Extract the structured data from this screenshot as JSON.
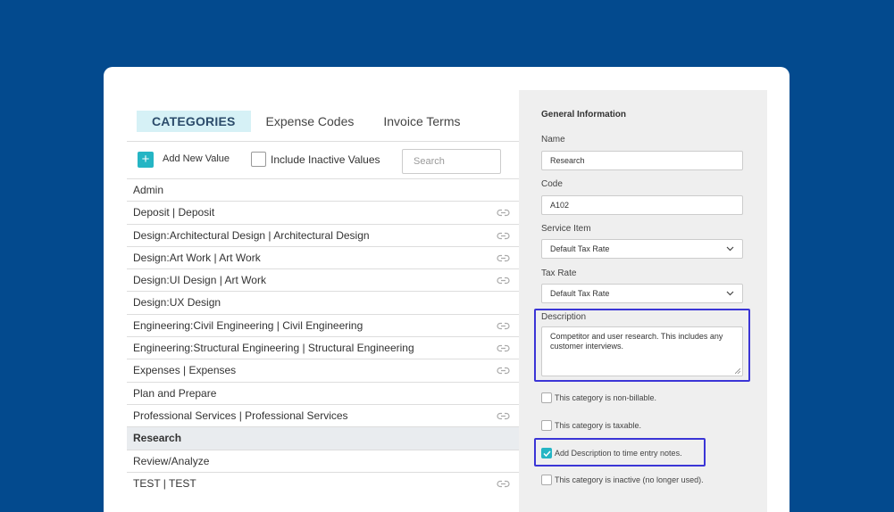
{
  "tabs": [
    {
      "label": "CATEGORIES"
    },
    {
      "label": "Expense Codes"
    },
    {
      "label": "Invoice Terms"
    }
  ],
  "toolbar": {
    "add_label": "Add New Value",
    "include_inactive_label": "Include Inactive Values",
    "search_placeholder": "Search"
  },
  "categories": [
    {
      "label": "Admin",
      "linked": false,
      "selected": false
    },
    {
      "label": "Deposit | Deposit",
      "linked": true,
      "selected": false
    },
    {
      "label": "Design:Architectural Design | Architectural Design",
      "linked": true,
      "selected": false
    },
    {
      "label": "Design:Art Work | Art Work",
      "linked": true,
      "selected": false
    },
    {
      "label": "Design:UI Design | Art Work",
      "linked": true,
      "selected": false
    },
    {
      "label": "Design:UX Design",
      "linked": false,
      "selected": false
    },
    {
      "label": "Engineering:Civil Engineering | Civil Engineering",
      "linked": true,
      "selected": false
    },
    {
      "label": "Engineering:Structural Engineering | Structural Engineering",
      "linked": true,
      "selected": false
    },
    {
      "label": "Expenses | Expenses",
      "linked": true,
      "selected": false
    },
    {
      "label": "Plan and Prepare",
      "linked": false,
      "selected": false
    },
    {
      "label": "Professional Services | Professional Services",
      "linked": true,
      "selected": false
    },
    {
      "label": "Research",
      "linked": false,
      "selected": true
    },
    {
      "label": "Review/Analyze",
      "linked": false,
      "selected": false
    },
    {
      "label": "TEST | TEST",
      "linked": true,
      "selected": false
    }
  ],
  "detail": {
    "section_title": "General Information",
    "name_label": "Name",
    "name_value": "Research",
    "code_label": "Code",
    "code_value": "A102",
    "service_item_label": "Service Item",
    "service_item_value": "Default Tax Rate",
    "tax_rate_label": "Tax Rate",
    "tax_rate_value": "Default Tax Rate",
    "description_label": "Description",
    "description_value": "Competitor and user research. This includes any customer interviews.",
    "checkboxes": [
      {
        "label": "This category is non-billable.",
        "checked": false
      },
      {
        "label": "This category is taxable.",
        "checked": false
      },
      {
        "label": "Add Description to time entry notes.",
        "checked": true
      },
      {
        "label": "This category is inactive (no longer used).",
        "checked": false
      }
    ]
  },
  "colors": {
    "background": "#034a8e",
    "accent": "#25b5c4",
    "highlight_border": "#3b35d6",
    "active_tab_bg": "#d6f1f6"
  }
}
